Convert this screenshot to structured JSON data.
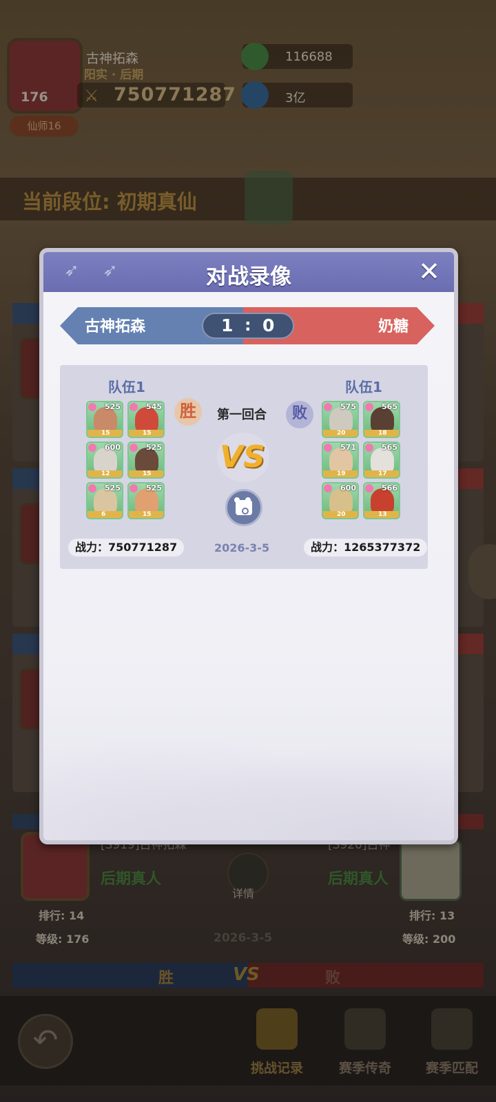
{
  "background": {
    "player": {
      "name": "古神拓森",
      "realm": "阳实 · 后期",
      "level": "176",
      "title_badge": "仙师16",
      "power": "750771287"
    },
    "resources": [
      {
        "icon": "jade-plus-icon",
        "value": "116688"
      },
      {
        "icon": "spirit-stone-plus-icon",
        "value": "3亿"
      }
    ],
    "rank_text": "当前段位: 初期真仙",
    "bottom_card": {
      "left": {
        "name": "[S919]古神拓森",
        "realm": "后期真人",
        "rank": "排行: 14",
        "level": "等级: 176"
      },
      "right": {
        "name": "[S920]古神",
        "realm": "后期真人",
        "rank": "排行: 13",
        "level": "等级: 200"
      },
      "detail_label": "详情",
      "date": "2026-3-5",
      "result_win": "胜",
      "result_vs": "VS",
      "result_lose": "败"
    },
    "nav": [
      {
        "label": "挑战记录",
        "icon": "record-icon",
        "active": true
      },
      {
        "label": "赛季传奇",
        "icon": "legend-icon",
        "active": false
      },
      {
        "label": "赛季匹配",
        "icon": "match-icon",
        "active": false
      }
    ]
  },
  "modal": {
    "title": "对战录像",
    "score": {
      "left_name": "古神拓森",
      "right_name": "奶糖",
      "left_score": "1",
      "separator": ":",
      "right_score": "0"
    },
    "battle": {
      "left_team_label": "队伍1",
      "right_team_label": "队伍1",
      "round_label": "第一回合",
      "left_result": "胜",
      "right_result": "败",
      "vs": "VS",
      "date": "2026-3-5",
      "left_power": "战力：750771287",
      "right_power": "战力：1265377372",
      "left_heroes": [
        {
          "level": "525",
          "stars": "15",
          "face": "#c98a6a"
        },
        {
          "level": "545",
          "stars": "15",
          "face": "#d04a3c"
        },
        {
          "level": "600",
          "stars": "12",
          "face": "#d8d4cc"
        },
        {
          "level": "525",
          "stars": "15",
          "face": "#6a4a3a"
        },
        {
          "level": "525",
          "stars": "6",
          "face": "#d9c6a0"
        },
        {
          "level": "525",
          "stars": "15",
          "face": "#e0a070"
        }
      ],
      "right_heroes": [
        {
          "level": "575",
          "stars": "20",
          "face": "#cfcac0"
        },
        {
          "level": "565",
          "stars": "18",
          "face": "#5a4032"
        },
        {
          "level": "571",
          "stars": "19",
          "face": "#e2c6a4"
        },
        {
          "level": "565",
          "stars": "17",
          "face": "#e4e0dc"
        },
        {
          "level": "600",
          "stars": "20",
          "face": "#d8c08c"
        },
        {
          "level": "566",
          "stars": "13",
          "face": "#c8402e"
        }
      ]
    }
  }
}
